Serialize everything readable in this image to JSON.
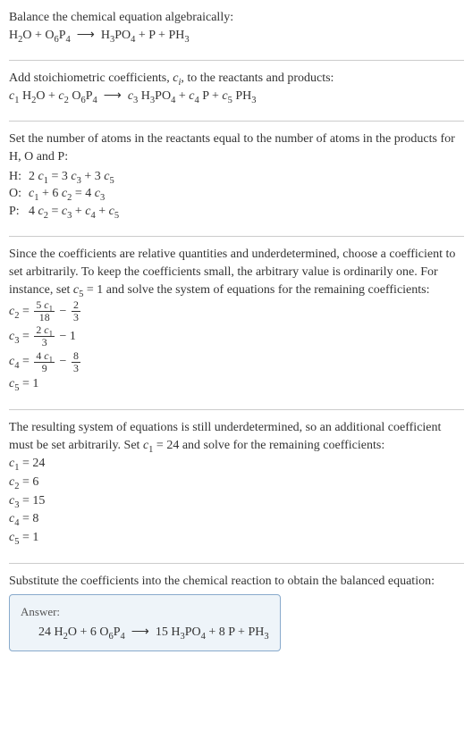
{
  "intro": {
    "line1": "Balance the chemical equation algebraically:",
    "equation_html": "H<sub>2</sub>O + O<sub>6</sub>P<sub>4</sub> &nbsp;⟶&nbsp; H<sub>3</sub>PO<sub>4</sub> + P + PH<sub>3</sub>"
  },
  "stoich": {
    "line1_html": "Add stoichiometric coefficients, <span class='italic-i'>c<sub>i</sub></span>, to the reactants and products:",
    "equation_html": "<span class='italic-i'>c</span><sub>1</sub> H<sub>2</sub>O + <span class='italic-i'>c</span><sub>2</sub> O<sub>6</sub>P<sub>4</sub> &nbsp;⟶&nbsp; <span class='italic-i'>c</span><sub>3</sub> H<sub>3</sub>PO<sub>4</sub> + <span class='italic-i'>c</span><sub>4</sub> P + <span class='italic-i'>c</span><sub>5</sub> PH<sub>3</sub>"
  },
  "atoms": {
    "intro": "Set the number of atoms in the reactants equal to the number of atoms in the products for H, O and P:",
    "rows": [
      {
        "el": "H:",
        "eq_html": "2 <span class='italic-i'>c</span><sub>1</sub> = 3 <span class='italic-i'>c</span><sub>3</sub> + 3 <span class='italic-i'>c</span><sub>5</sub>"
      },
      {
        "el": "O:",
        "eq_html": "<span class='italic-i'>c</span><sub>1</sub> + 6 <span class='italic-i'>c</span><sub>2</sub> = 4 <span class='italic-i'>c</span><sub>3</sub>"
      },
      {
        "el": "P:",
        "eq_html": "4 <span class='italic-i'>c</span><sub>2</sub> = <span class='italic-i'>c</span><sub>3</sub> + <span class='italic-i'>c</span><sub>4</sub> + <span class='italic-i'>c</span><sub>5</sub>"
      }
    ]
  },
  "relative": {
    "intro_html": "Since the coefficients are relative quantities and underdetermined, choose a coefficient to set arbitrarily. To keep the coefficients small, the arbitrary value is ordinarily one. For instance, set <span class='italic-i'>c</span><sub>5</sub> = 1 and solve the system of equations for the remaining coefficients:",
    "eqs": [
      {
        "lhs_html": "<span class='italic-i'>c</span><sub>2</sub> = ",
        "rhs_html": "<span class='frac'><span class='num'>5 <span class='italic-i'>c</span><sub>1</sub></span><span class='den'>18</span></span> − <span class='frac'><span class='num'>2</span><span class='den'>3</span></span>"
      },
      {
        "lhs_html": "<span class='italic-i'>c</span><sub>3</sub> = ",
        "rhs_html": "<span class='frac'><span class='num'>2 <span class='italic-i'>c</span><sub>1</sub></span><span class='den'>3</span></span> − 1"
      },
      {
        "lhs_html": "<span class='italic-i'>c</span><sub>4</sub> = ",
        "rhs_html": "<span class='frac'><span class='num'>4 <span class='italic-i'>c</span><sub>1</sub></span><span class='den'>9</span></span> − <span class='frac'><span class='num'>8</span><span class='den'>3</span></span>"
      },
      {
        "lhs_html": "<span class='italic-i'>c</span><sub>5</sub> = ",
        "rhs_html": "1"
      }
    ]
  },
  "resulting": {
    "intro_html": "The resulting system of equations is still underdetermined, so an additional coefficient must be set arbitrarily. Set <span class='italic-i'>c</span><sub>1</sub> = 24 and solve for the remaining coefficients:",
    "eqs": [
      {
        "html": "<span class='italic-i'>c</span><sub>1</sub> = 24"
      },
      {
        "html": "<span class='italic-i'>c</span><sub>2</sub> = 6"
      },
      {
        "html": "<span class='italic-i'>c</span><sub>3</sub> = 15"
      },
      {
        "html": "<span class='italic-i'>c</span><sub>4</sub> = 8"
      },
      {
        "html": "<span class='italic-i'>c</span><sub>5</sub> = 1"
      }
    ]
  },
  "final": {
    "intro": "Substitute the coefficients into the chemical reaction to obtain the balanced equation:",
    "answer_label": "Answer:",
    "equation_html": "24 H<sub>2</sub>O + 6 O<sub>6</sub>P<sub>4</sub> &nbsp;⟶&nbsp; 15 H<sub>3</sub>PO<sub>4</sub> + 8 P + PH<sub>3</sub>"
  },
  "chart_data": {
    "type": "table",
    "title": "Balanced chemical equation coefficients",
    "unbalanced_equation": "H2O + O6P4 -> H3PO4 + P + PH3",
    "element_balance": [
      {
        "element": "H",
        "equation": "2 c1 = 3 c3 + 3 c5"
      },
      {
        "element": "O",
        "equation": "c1 + 6 c2 = 4 c3"
      },
      {
        "element": "P",
        "equation": "4 c2 = c3 + c4 + c5"
      }
    ],
    "parametric_solution_set_c5_1": [
      {
        "var": "c2",
        "expr": "5 c1 / 18 - 2/3"
      },
      {
        "var": "c3",
        "expr": "2 c1 / 3 - 1"
      },
      {
        "var": "c4",
        "expr": "4 c1 / 9 - 8/3"
      },
      {
        "var": "c5",
        "expr": "1"
      }
    ],
    "chosen_c1": 24,
    "coefficients": {
      "c1": 24,
      "c2": 6,
      "c3": 15,
      "c4": 8,
      "c5": 1
    },
    "balanced_equation": "24 H2O + 6 O6P4 -> 15 H3PO4 + 8 P + PH3"
  }
}
